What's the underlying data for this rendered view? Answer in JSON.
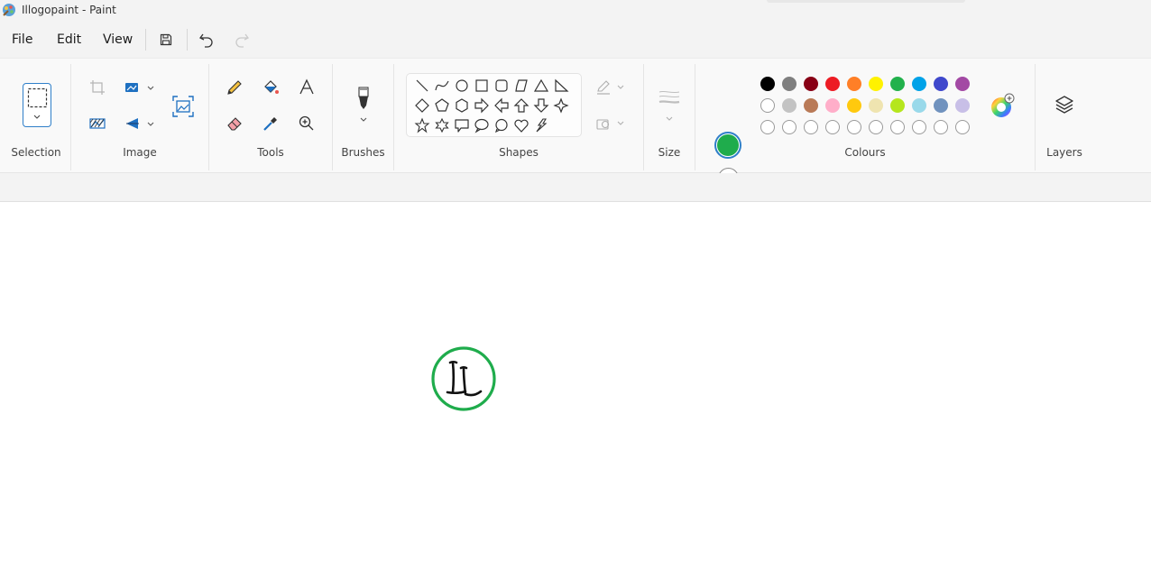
{
  "window": {
    "title": "Illogopaint - Paint"
  },
  "menu": {
    "file": "File",
    "edit": "Edit",
    "view": "View"
  },
  "quick_actions": {
    "save": "save-icon",
    "undo": "undo-icon",
    "redo": "redo-icon"
  },
  "ribbon": {
    "groups": {
      "selection": "Selection",
      "image": "Image",
      "tools": "Tools",
      "brushes": "Brushes",
      "shapes": "Shapes",
      "size": "Size",
      "colours": "Colours",
      "layers": "Layers"
    },
    "shapes": [
      "line",
      "curve",
      "oval",
      "rectangle",
      "rounded-rectangle",
      "polygon",
      "triangle",
      "right-triangle",
      "diamond",
      "pentagon",
      "hexagon",
      "arrow-left-right",
      "arrow-left",
      "arrow-up",
      "arrow-down",
      "four-point-star",
      "five-point-star",
      "six-point-star",
      "callout-rectangle",
      "callout-oval",
      "callout-cloud",
      "heart",
      "lightning"
    ]
  },
  "colours": {
    "colour1": "#1fac4c",
    "colour2": "#ffffff",
    "palette_row1": [
      "#000000",
      "#7f7f7f",
      "#880015",
      "#ed1c24",
      "#ff7f27",
      "#fff200",
      "#22b14c",
      "#00a2e8",
      "#3f48cc",
      "#a349a4"
    ],
    "palette_row2": [
      "#ffffff",
      "#c3c3c3",
      "#b97a57",
      "#ffaec9",
      "#ffc90e",
      "#efe4b0",
      "#b5e61d",
      "#99d9ea",
      "#7092be",
      "#c8bfe7"
    ]
  },
  "canvas": {
    "drawing": "L L monogram in green circle",
    "stroke_color": "#1fac4c"
  }
}
